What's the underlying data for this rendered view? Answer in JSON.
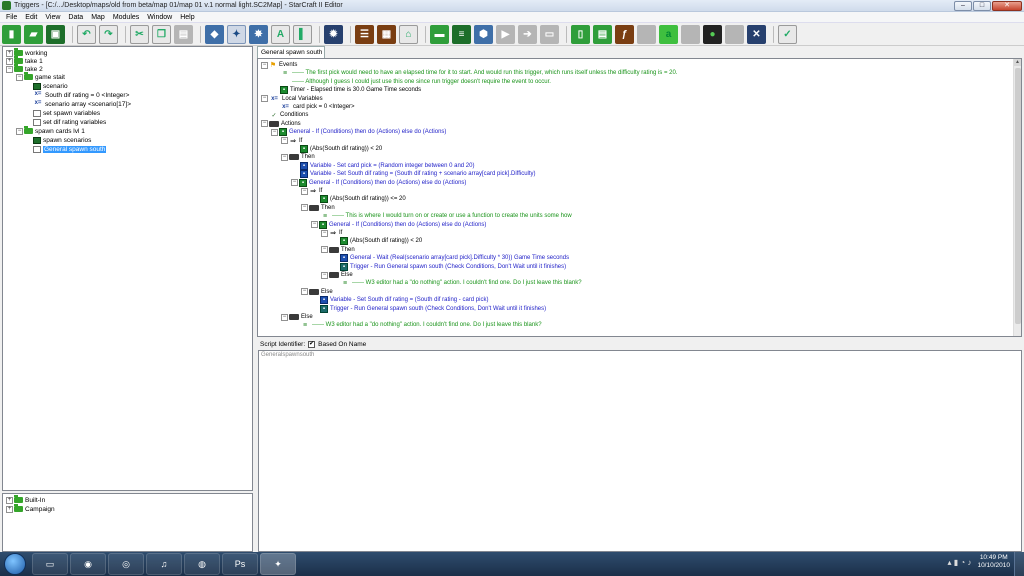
{
  "window": {
    "title": "Triggers - [C:/.../Desktop/maps/old from beta/map 01/map 01 v.1  normal light.SC2Map] - StarCraft II Editor",
    "min": "–",
    "max": "□",
    "close": "✕"
  },
  "menu": [
    "File",
    "Edit",
    "View",
    "Data",
    "Map",
    "Modules",
    "Window",
    "Help"
  ],
  "left_tree": [
    {
      "label": "working",
      "type": "folder",
      "level": 0,
      "expander": "+"
    },
    {
      "label": "take 1",
      "type": "folder",
      "level": 0,
      "expander": "+"
    },
    {
      "label": "take 2",
      "type": "folder",
      "level": 0,
      "expander": "−"
    },
    {
      "label": "game stait",
      "type": "folder",
      "level": 1,
      "expander": "−"
    },
    {
      "label": "scenario",
      "type": "trigger",
      "level": 2
    },
    {
      "label": "South dif rating = 0 <Integer>",
      "type": "var",
      "level": 2
    },
    {
      "label": "scenario array <scenario[17]>",
      "type": "var",
      "level": 2
    },
    {
      "label": "set spawn variables",
      "type": "doc",
      "level": 2
    },
    {
      "label": "set dif rating variables",
      "type": "doc",
      "level": 2
    },
    {
      "label": "spawn cards lvl 1",
      "type": "folder",
      "level": 1,
      "expander": "−"
    },
    {
      "label": "spawn scenarios",
      "type": "trigger",
      "level": 2
    },
    {
      "label": "General spawn south",
      "type": "doc",
      "level": 2,
      "selected": true
    }
  ],
  "library_tree": [
    {
      "label": "Built-In",
      "expander": "+"
    },
    {
      "label": "Campaign",
      "expander": "+"
    }
  ],
  "trigger_tab": "General spawn south",
  "trigger_lines": [
    {
      "indent": 0,
      "exp": "−",
      "icon": "flag",
      "text": "Events",
      "color": "black"
    },
    {
      "indent": 1,
      "icon": "comment",
      "text": "------ The first pick would need to have an elapsed time for it to start.  And would run this trigger, which runs itself unless the difficulty rating is = 20.",
      "color": "green"
    },
    {
      "indent": 1,
      "icon": "none",
      "text": "------ Although I guess I could just use this one since run trigger doesn't require the event to occur.",
      "color": "green"
    },
    {
      "indent": 1,
      "icon": "green",
      "text": "Timer - Elapsed time is 30.0 Game Time seconds",
      "color": "black"
    },
    {
      "indent": 0,
      "exp": "−",
      "icon": "varico",
      "text": "Local Variables",
      "color": "black"
    },
    {
      "indent": 1,
      "icon": "varico",
      "text": "card pick = 0 <Integer>",
      "color": "black"
    },
    {
      "indent": 0,
      "icon": "check",
      "text": "Conditions",
      "color": "black"
    },
    {
      "indent": 0,
      "exp": "−",
      "icon": "folder-ico",
      "text": "Actions",
      "color": "black"
    },
    {
      "indent": 1,
      "exp": "−",
      "icon": "green",
      "text": "General - If (Conditions) then do (Actions) else do (Actions)",
      "color": "blue"
    },
    {
      "indent": 2,
      "exp": "−",
      "icon": "arrow",
      "text": "If",
      "color": "black"
    },
    {
      "indent": 3,
      "icon": "green",
      "text": "(Abs(South dif rating)) < 20",
      "color": "black"
    },
    {
      "indent": 2,
      "exp": "−",
      "icon": "folder-ico",
      "text": "Then",
      "color": "black"
    },
    {
      "indent": 3,
      "icon": "blue",
      "text": "Variable - Set card pick = (Random integer between 0 and 20)",
      "color": "blue"
    },
    {
      "indent": 3,
      "icon": "blue",
      "text": "Variable - Set South dif rating = (South dif rating + scenario array[card pick].Difficulty)",
      "color": "blue"
    },
    {
      "indent": 3,
      "exp": "−",
      "icon": "green",
      "text": "General - If (Conditions) then do (Actions) else do (Actions)",
      "color": "blue"
    },
    {
      "indent": 4,
      "exp": "−",
      "icon": "arrow",
      "text": "If",
      "color": "black"
    },
    {
      "indent": 5,
      "icon": "green",
      "text": "(Abs(South dif rating)) <= 20",
      "color": "black"
    },
    {
      "indent": 4,
      "exp": "−",
      "icon": "folder-ico",
      "text": "Then",
      "color": "black"
    },
    {
      "indent": 5,
      "icon": "comment",
      "text": "------ This is where I would turn on or create or use a function to create the units some how",
      "color": "green"
    },
    {
      "indent": 5,
      "exp": "−",
      "icon": "green",
      "text": "General - If (Conditions) then do (Actions) else do (Actions)",
      "color": "blue"
    },
    {
      "indent": 6,
      "exp": "−",
      "icon": "arrow",
      "text": "If",
      "color": "black"
    },
    {
      "indent": 7,
      "icon": "green",
      "text": "(Abs(South dif rating)) < 20",
      "color": "black"
    },
    {
      "indent": 6,
      "exp": "−",
      "icon": "folder-ico",
      "text": "Then",
      "color": "black"
    },
    {
      "indent": 7,
      "icon": "blue",
      "text": "General - Wait (Real(scenario array[card pick].Difficulty * 30)) Game Time seconds",
      "color": "blue"
    },
    {
      "indent": 7,
      "icon": "teal",
      "text": "Trigger - Run General spawn south  (Check Conditions, Don't Wait until it finishes)",
      "color": "blue"
    },
    {
      "indent": 6,
      "exp": "−",
      "icon": "folder-ico",
      "text": "Else",
      "color": "black"
    },
    {
      "indent": 7,
      "icon": "comment",
      "text": "------ W3 editor had a \"do nothing\" action.  I couldn't find one.  Do I just leave this blank?",
      "color": "green"
    },
    {
      "indent": 4,
      "exp": "−",
      "icon": "folder-ico",
      "text": "Else",
      "color": "black"
    },
    {
      "indent": 5,
      "icon": "blue",
      "text": "Variable - Set South dif rating = (South dif rating - card pick)",
      "color": "blue"
    },
    {
      "indent": 5,
      "icon": "teal",
      "text": "Trigger - Run General spawn south  (Check Conditions, Don't Wait until it finishes)",
      "color": "blue"
    },
    {
      "indent": 2,
      "exp": "−",
      "icon": "folder-ico",
      "text": "Else",
      "color": "black"
    },
    {
      "indent": 3,
      "icon": "comment",
      "text": "------ W3 editor had a \"do nothing\" action.  I couldn't find one.  Do I just leave this blank?",
      "color": "green"
    }
  ],
  "script": {
    "identifier_label": "Script Identifier:",
    "based_on_name_label": "Based On Name",
    "based_on_name_checked": true,
    "value": "Generalspawnsouth"
  },
  "taskbar": {
    "time": "10:49 PM",
    "date": "10/10/2010"
  },
  "colors": {
    "green_text": "#199319",
    "blue_text": "#2323c8",
    "selection": "#3399ff"
  }
}
